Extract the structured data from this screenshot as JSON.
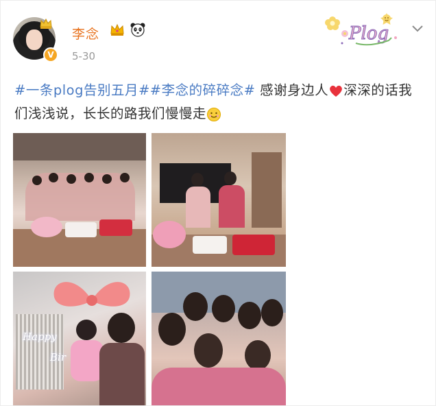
{
  "post": {
    "username": "李念",
    "date": "5-30",
    "text_parts": {
      "tag1": "#一条plog告别五月#",
      "tag2": "#李念的碎碎念#",
      "body1": " 感谢身边人",
      "body2": "深深的话我们浅浅说，长长的路我们慢慢走"
    },
    "sticker_label": "Plog",
    "photo_texts": {
      "sign_line1": "Happy",
      "sign_line2": "Bir"
    }
  },
  "icons": {
    "verified": "verified-v-icon",
    "crown": "crown-icon",
    "panda": "panda-icon",
    "heart": "red-heart-icon",
    "smile": "smile-emoji-icon",
    "more": "chevron-down-icon"
  },
  "colors": {
    "username": "#e8731f",
    "hashtag": "#4a7bc3",
    "date": "#9a9a9a"
  }
}
